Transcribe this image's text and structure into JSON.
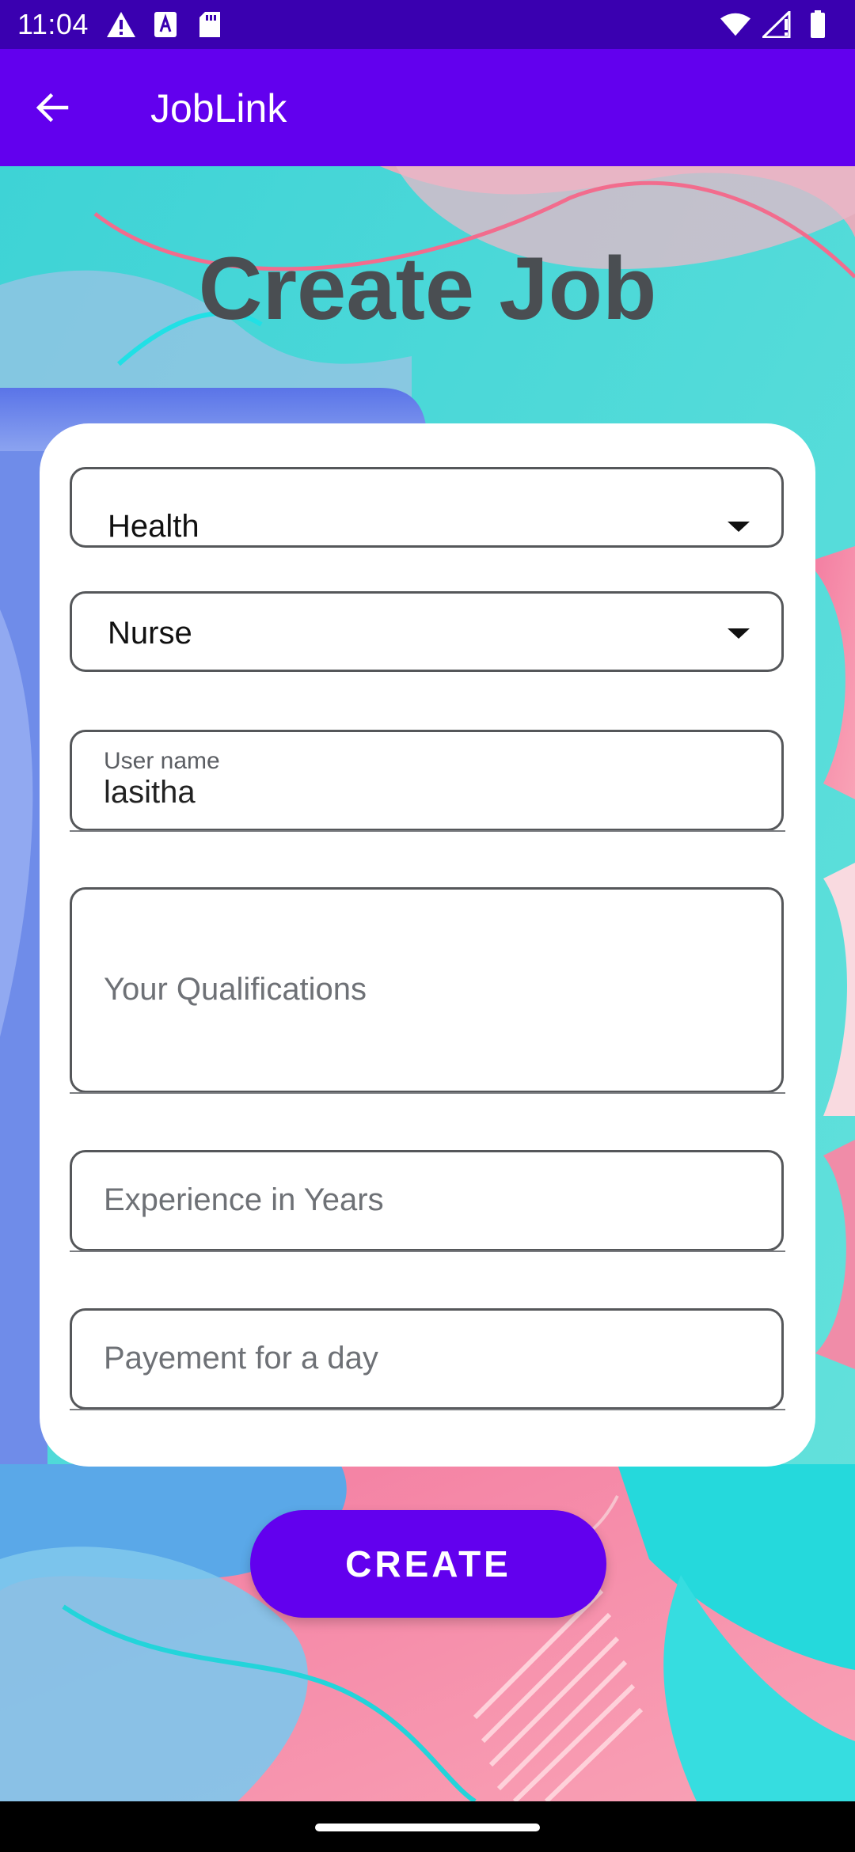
{
  "status_bar": {
    "time": "11:04",
    "left_icons": [
      "alert-icon",
      "a-icon",
      "sd-card-icon"
    ],
    "right_icons": [
      "wifi-icon",
      "signal-icon",
      "battery-icon"
    ]
  },
  "app_bar": {
    "title": "JobLink",
    "back_icon": "arrow-left-icon"
  },
  "heading": "Create Job",
  "form": {
    "category_spinner": {
      "value": "Health"
    },
    "role_spinner": {
      "value": "Nurse"
    },
    "username": {
      "label": "User name",
      "value": "lasitha"
    },
    "qualifications": {
      "placeholder": "Your Qualifications"
    },
    "experience": {
      "placeholder": "Experience in Years"
    },
    "payment": {
      "placeholder": "Payement for a day"
    }
  },
  "create_button": {
    "label": "CREATE"
  },
  "colors": {
    "status_bar": "#3A00B0",
    "app_bar": "#6200EE",
    "button": "#6200EE",
    "heading": "#4A4E52"
  }
}
